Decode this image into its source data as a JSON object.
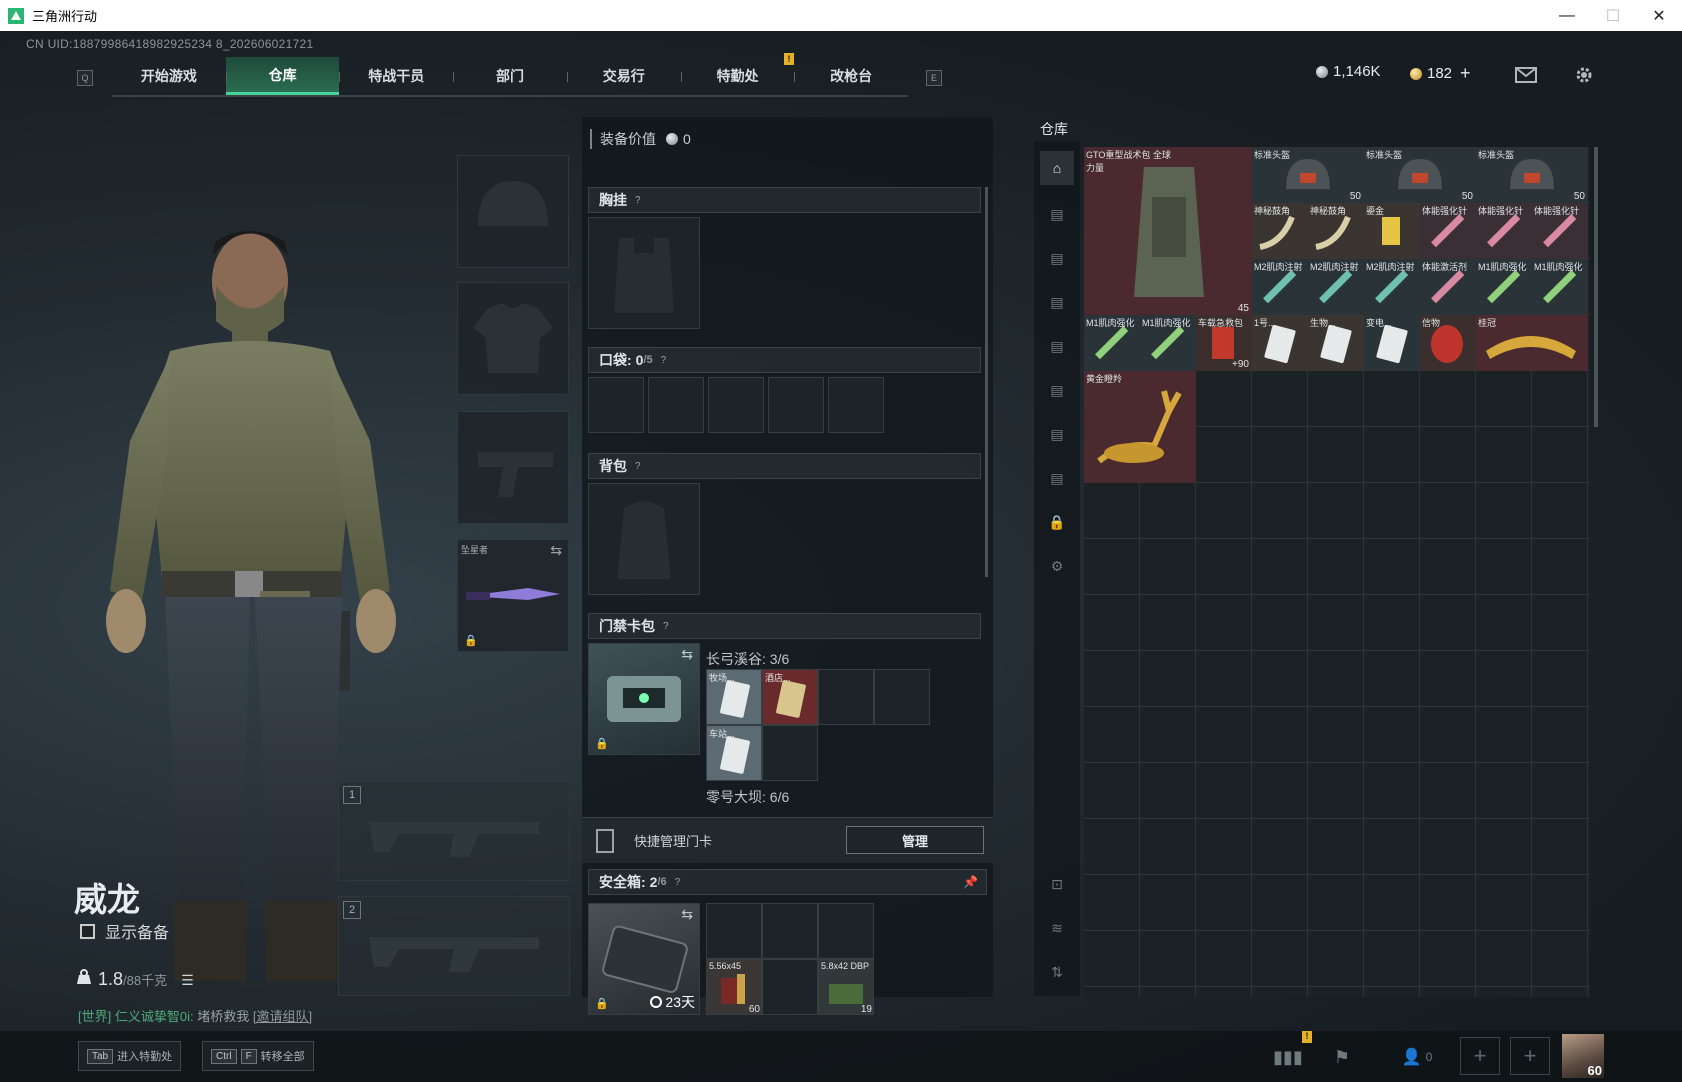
{
  "window": {
    "title": "三角洲行动",
    "controls": {
      "minimize": "—",
      "maximize": "☐",
      "close": "✕"
    }
  },
  "uid_text": "CN UID:18879986418982925234 8_202606021721",
  "nav": {
    "left_key": "Q",
    "right_key": "E",
    "tabs": [
      "开始游戏",
      "仓库",
      "特战干员",
      "部门",
      "交易行",
      "特勤处",
      "改枪台"
    ],
    "active_index": 1,
    "notif_mark": "!"
  },
  "currency": {
    "silver": "1,146K",
    "gold": "182",
    "gold_add": "+"
  },
  "operator": {
    "name": "威龙",
    "show_equipment": "显示备备",
    "weight_value": "1.8",
    "weight_max": "/88千克"
  },
  "chat": {
    "channel": "[世界]",
    "user": "仁义诚挚智0i:",
    "message": "堵桥救我",
    "invite": "[邀请组队]"
  },
  "gear": {
    "melee_label": "坠星者",
    "weapon1_num": "1",
    "weapon2_num": "2"
  },
  "equip_panel": {
    "value_label": "装备价值",
    "value": "0",
    "chest_rig": "胸挂",
    "pockets": "口袋:",
    "pockets_count": "0",
    "pockets_max": "/5",
    "backpack": "背包",
    "keycard_case": "门禁卡包",
    "q": "?",
    "keycard_map1": "长弓溪谷: 3/6",
    "keycard_map2": "零号大坝: 6/6",
    "keycards_map1": [
      "牧场...",
      "酒店...",
      "车站..."
    ],
    "quick_manage": "快捷管理门卡",
    "manage_btn": "管理",
    "safebox": "安全箱:",
    "safebox_count": "2",
    "safebox_max": "/6",
    "safebox_days": "23天",
    "safebox_items": [
      {
        "name": "5.56x45",
        "qty": "60"
      },
      {
        "name": "5.8x42 DBP",
        "qty": "19"
      }
    ]
  },
  "warehouse": {
    "title": "仓库",
    "items": [
      {
        "name": "GTO重型战术包 全球力量",
        "qty": "45"
      },
      {
        "name": "标准头盔",
        "qty": "50"
      },
      {
        "name": "标准头盔",
        "qty": "50"
      },
      {
        "name": "标准头盔",
        "qty": "50"
      },
      {
        "name": "神秘鼓角",
        "qty": ""
      },
      {
        "name": "神秘鼓角",
        "qty": ""
      },
      {
        "name": "鎏金",
        "qty": ""
      },
      {
        "name": "体能强化针",
        "qty": ""
      },
      {
        "name": "体能强化针",
        "qty": ""
      },
      {
        "name": "体能强化针",
        "qty": ""
      },
      {
        "name": "M2肌肉注射",
        "qty": ""
      },
      {
        "name": "M2肌肉注射",
        "qty": ""
      },
      {
        "name": "M2肌肉注射",
        "qty": ""
      },
      {
        "name": "体能激活剂",
        "qty": ""
      },
      {
        "name": "M1肌肉强化",
        "qty": ""
      },
      {
        "name": "M1肌肉强化",
        "qty": ""
      },
      {
        "name": "M1肌肉强化",
        "qty": ""
      },
      {
        "name": "M1肌肉强化",
        "qty": ""
      },
      {
        "name": "车载急救包",
        "qty": "+90"
      },
      {
        "name": "1号...",
        "qty": ""
      },
      {
        "name": "生物...",
        "qty": ""
      },
      {
        "name": "变电...",
        "qty": ""
      },
      {
        "name": "信物",
        "qty": ""
      },
      {
        "name": "桂冠",
        "qty": ""
      },
      {
        "name": "黄金瞪羚",
        "qty": ""
      }
    ]
  },
  "bottom": {
    "tab_key": "Tab",
    "tab_label": "进入特勤处",
    "ctrl_key": "Ctrl",
    "f_key": "F",
    "transfer_label": "转移全部",
    "friends_count": "0",
    "player_level": "60"
  },
  "colors": {
    "accent_green": "#44d39a",
    "active_tab_bg": "#2b6c50",
    "rare_red": "#5a2a2c",
    "gold": "#e7b02a"
  }
}
